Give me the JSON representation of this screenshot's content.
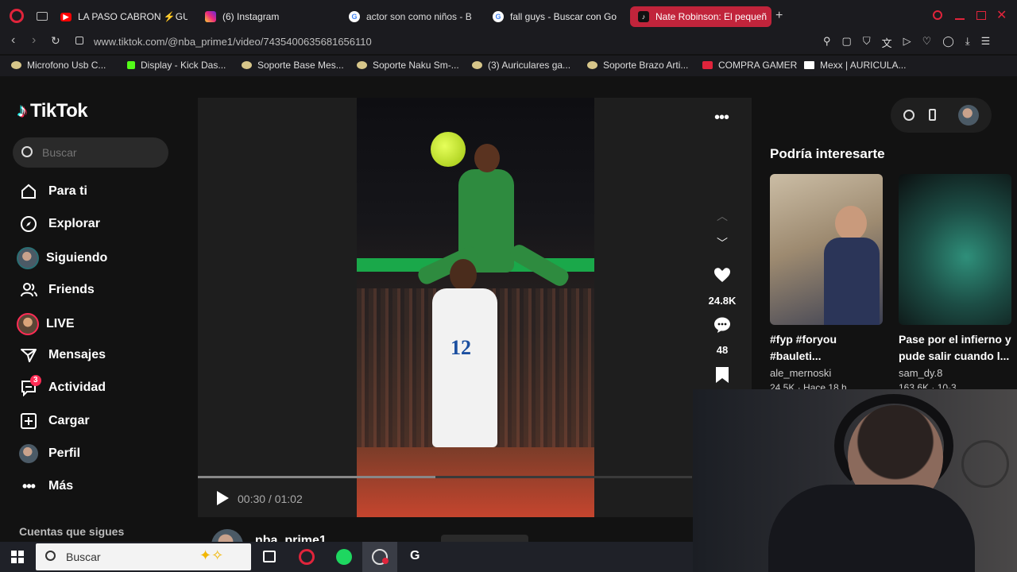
{
  "browser": {
    "tabs": [
      {
        "label": "LA PASO CABRON ⚡GU",
        "icon": "youtube-icon",
        "color": "#ff0000"
      },
      {
        "label": "(6) Instagram",
        "icon": "instagram-icon",
        "color": "#d6249f"
      },
      {
        "label": "actor son como niños - B",
        "icon": "google-icon",
        "color": "#4285f4"
      },
      {
        "label": "fall guys - Buscar con Go",
        "icon": "google-icon",
        "color": "#4285f4"
      },
      {
        "label": "Nate Robinson: El pequeñ",
        "icon": "tiktok-icon",
        "color": "#000000",
        "active": true
      }
    ],
    "url": "www.tiktok.com/@nba_prime1/video/7435400635681656110",
    "bookmarks": [
      "Microfono Usb C...",
      "Display - Kick Das...",
      "Soporte Base Mes...",
      "Soporte Naku Sm-...",
      "(3) Auriculares ga...",
      "Soporte Brazo Arti...",
      "COMPRA GAMER",
      "Mexx | AURICULA..."
    ],
    "accent": "#c1243b"
  },
  "tiktok": {
    "logo_text": "TikTok",
    "search_placeholder": "Buscar",
    "nav": [
      {
        "label": "Para ti",
        "icon": "home-icon"
      },
      {
        "label": "Explorar",
        "icon": "compass-icon"
      },
      {
        "label": "Siguiendo",
        "icon": "avatar"
      },
      {
        "label": "Friends",
        "icon": "friends-icon"
      },
      {
        "label": "LIVE",
        "icon": "avatar"
      },
      {
        "label": "Mensajes",
        "icon": "send-icon"
      },
      {
        "label": "Actividad",
        "icon": "inbox-icon",
        "badge": "3"
      },
      {
        "label": "Cargar",
        "icon": "plus-square-icon"
      },
      {
        "label": "Perfil",
        "icon": "avatar"
      },
      {
        "label": "Más",
        "icon": "more-horizontal-icon"
      }
    ],
    "following_heading": "Cuentas que sigues",
    "video": {
      "time": "00:30 / 01:02",
      "progress": 0.48,
      "likes": "24.8K",
      "comments": "48",
      "author": "nba_prime1"
    },
    "suggestions": {
      "heading": "Podría interesarte",
      "items": [
        {
          "title": "#fyp #foryou #bauleti...",
          "author": "ale_mernoski",
          "stats": "24.5K · Hace 18 h"
        },
        {
          "title": "Pase por el infierno y pude salir cuando l...",
          "author": "sam_dy.8",
          "stats": "163.6K · 10-3"
        }
      ]
    }
  },
  "taskbar": {
    "search_placeholder": "Buscar"
  }
}
